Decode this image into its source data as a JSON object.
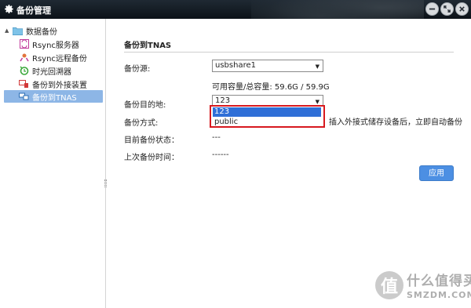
{
  "window": {
    "title": "备份管理"
  },
  "sidebar": {
    "root": {
      "label": "数据备份",
      "icon": "folder-icon"
    },
    "items": [
      {
        "label": "Rsync服务器",
        "icon": "rsync-server-icon",
        "selected": false
      },
      {
        "label": "Rsync远程备份",
        "icon": "rsync-remote-icon",
        "selected": false
      },
      {
        "label": "时光回溯器",
        "icon": "time-machine-icon",
        "selected": false
      },
      {
        "label": "备份到外接装置",
        "icon": "external-device-icon",
        "selected": false
      },
      {
        "label": "备份到TNAS",
        "icon": "tnas-icon",
        "selected": true
      }
    ]
  },
  "main": {
    "section_title": "备份到TNAS",
    "source": {
      "label": "备份源:",
      "value": "usbshare1"
    },
    "capacity": {
      "text": "可用容量/总容量: 59.6G / 59.9G"
    },
    "destination": {
      "label": "备份目的地:",
      "value": "123",
      "options": [
        "123",
        "public"
      ],
      "highlighted": "123"
    },
    "method": {
      "label": "备份方式:",
      "hint": "插入外接式储存设备后，立即自动备份"
    },
    "status": {
      "label": "目前备份状态：",
      "value": "---"
    },
    "last_time": {
      "label": "上次备份时间：",
      "value": "------"
    },
    "apply_label": "应用"
  },
  "watermark": {
    "cn": "什么值得买",
    "en": "SMZDM.COM"
  },
  "colors": {
    "titlebar": "#1f2933",
    "selection": "#8db6e6",
    "apply": "#4c8fe3",
    "highlight_box": "#d7191f",
    "option_highlight": "#2f6fd7"
  }
}
